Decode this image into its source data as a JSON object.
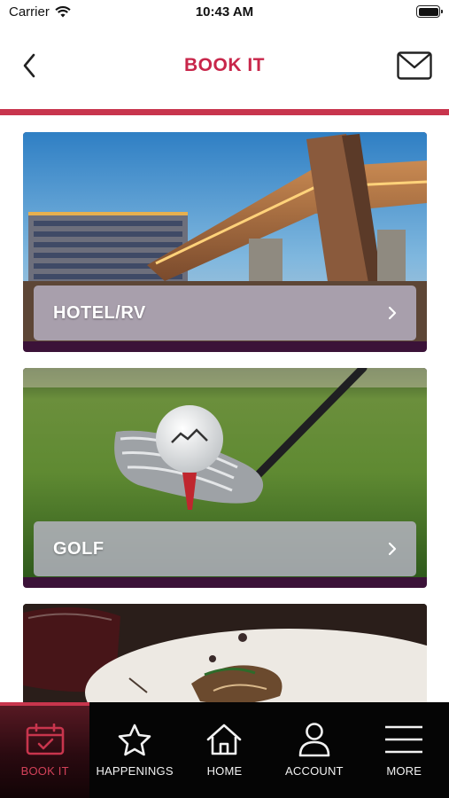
{
  "status_bar": {
    "carrier": "Carrier",
    "time": "10:43 AM"
  },
  "nav": {
    "title": "BOOK IT"
  },
  "colors": {
    "accent": "#c8264a",
    "tab_bar": "#050505",
    "card_backing": "#3b1238"
  },
  "cards": [
    {
      "label": "HOTEL/RV",
      "icon": "chevron-right-icon"
    },
    {
      "label": "GOLF",
      "icon": "chevron-right-icon"
    },
    {
      "label": "",
      "icon": ""
    }
  ],
  "tabs": [
    {
      "label": "BOOK IT",
      "icon": "calendar-check-icon",
      "active": true
    },
    {
      "label": "HAPPENINGS",
      "icon": "star-icon",
      "active": false
    },
    {
      "label": "HOME",
      "icon": "home-icon",
      "active": false
    },
    {
      "label": "ACCOUNT",
      "icon": "person-icon",
      "active": false
    },
    {
      "label": "MORE",
      "icon": "menu-icon",
      "active": false
    }
  ]
}
